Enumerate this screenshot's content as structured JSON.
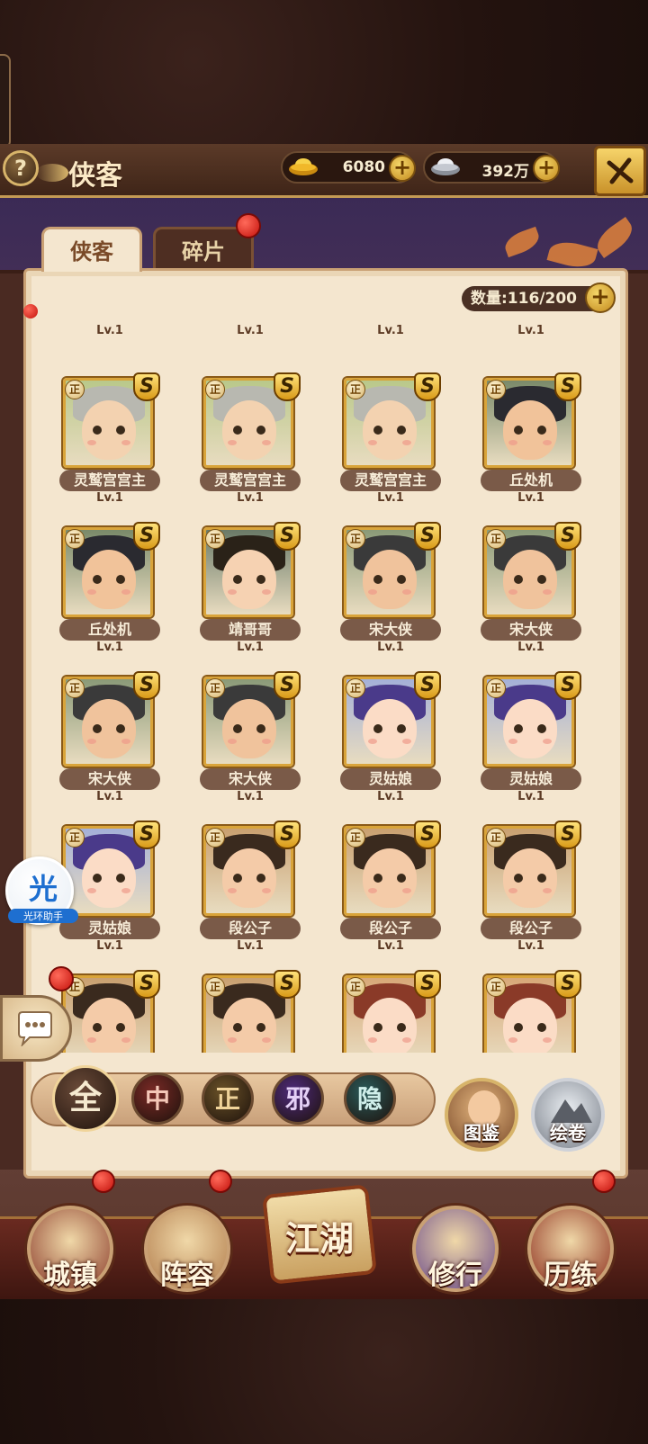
{
  "header": {
    "title": "侠客",
    "gold": "6080",
    "silver": "392万"
  },
  "tabs": [
    {
      "label": "侠客",
      "active": true
    },
    {
      "label": "碎片",
      "active": false,
      "badge": true
    }
  ],
  "count_label": "数量:116/200",
  "heroes": [
    {
      "name": "灵鹫宫宫主",
      "level": "Lv.1",
      "skin": "#f3d2b0",
      "hair": "#b8b8b0",
      "bg": "#b9c88a"
    },
    {
      "name": "灵鹫宫宫主",
      "level": "Lv.1",
      "skin": "#f3d2b0",
      "hair": "#b8b8b0",
      "bg": "#b9c88a"
    },
    {
      "name": "灵鹫宫宫主",
      "level": "Lv.1",
      "skin": "#f3d2b0",
      "hair": "#b8b8b0",
      "bg": "#b9c88a"
    },
    {
      "name": "丘处机",
      "level": "Lv.1",
      "skin": "#f1c39a",
      "hair": "#2a2a30",
      "bg": "#7a8a6a"
    },
    {
      "name": "丘处机",
      "level": "Lv.1",
      "skin": "#f1c39a",
      "hair": "#2a2a30",
      "bg": "#7a8a6a"
    },
    {
      "name": "靖哥哥",
      "level": "Lv.1",
      "skin": "#f6d2b2",
      "hair": "#2a2218",
      "bg": "#6a7a68"
    },
    {
      "name": "宋大侠",
      "level": "Lv.1",
      "skin": "#f0c39c",
      "hair": "#3a3a3a",
      "bg": "#8a9a78"
    },
    {
      "name": "宋大侠",
      "level": "Lv.1",
      "skin": "#f0c39c",
      "hair": "#3a3a3a",
      "bg": "#8a9a78"
    },
    {
      "name": "宋大侠",
      "level": "Lv.1",
      "skin": "#f0c39c",
      "hair": "#3a3a3a",
      "bg": "#8a9a78"
    },
    {
      "name": "宋大侠",
      "level": "Lv.1",
      "skin": "#f0c39c",
      "hair": "#3a3a3a",
      "bg": "#8a9a78"
    },
    {
      "name": "灵姑娘",
      "level": "Lv.1",
      "skin": "#fbdcc6",
      "hair": "#4a3a8a",
      "bg": "#a4b0d8"
    },
    {
      "name": "灵姑娘",
      "level": "Lv.1",
      "skin": "#fbdcc6",
      "hair": "#4a3a8a",
      "bg": "#a4b0d8"
    },
    {
      "name": "灵姑娘",
      "level": "Lv.1",
      "skin": "#fbdcc6",
      "hair": "#4a3a8a",
      "bg": "#a4b0d8"
    },
    {
      "name": "段公子",
      "level": "Lv.1",
      "skin": "#f4cba8",
      "hair": "#3a2a1e",
      "bg": "#c9a070"
    },
    {
      "name": "段公子",
      "level": "Lv.1",
      "skin": "#f4cba8",
      "hair": "#3a2a1e",
      "bg": "#c9a070"
    },
    {
      "name": "段公子",
      "level": "Lv.1",
      "skin": "#f4cba8",
      "hair": "#3a2a1e",
      "bg": "#c9a070"
    },
    {
      "name": "",
      "level": "",
      "skin": "#f4cba8",
      "hair": "#3a2a1e",
      "bg": "#c9a070"
    },
    {
      "name": "",
      "level": "",
      "skin": "#f4cba8",
      "hair": "#3a2a1e",
      "bg": "#c9a070"
    },
    {
      "name": "",
      "level": "",
      "skin": "#fbdcc6",
      "hair": "#8a3a28",
      "bg": "#d8a878"
    },
    {
      "name": "",
      "level": "",
      "skin": "#fbdcc6",
      "hair": "#8a3a28",
      "bg": "#d8a878"
    }
  ],
  "top_partial_levels": [
    "Lv.1",
    "Lv.1",
    "Lv.1",
    "Lv.1"
  ],
  "faction_badge": "正",
  "rank_badge": "S",
  "filters": [
    {
      "label": "全",
      "color": "#f5ead0",
      "bg": "#6a4a38",
      "selected": true
    },
    {
      "label": "中",
      "color": "#f4c8b8",
      "bg": "#7a2a26"
    },
    {
      "label": "正",
      "color": "#f0d49a",
      "bg": "#6a5228"
    },
    {
      "label": "邪",
      "color": "#e4d0f6",
      "bg": "#4e2a7a"
    },
    {
      "label": "隐",
      "color": "#cfeeea",
      "bg": "#2a5a5a"
    }
  ],
  "side_buttons": {
    "codex": "图鉴",
    "scrolls": "绘卷"
  },
  "assistant": {
    "glyph": "光",
    "label": "光环助手"
  },
  "nav": [
    {
      "label": "城镇",
      "badge": true
    },
    {
      "label": "阵容",
      "badge": true
    },
    {
      "label": "江湖",
      "badge": false
    },
    {
      "label": "修行",
      "badge": false
    },
    {
      "label": "历练",
      "badge": true
    }
  ],
  "colors": {
    "gold": "#d9a43a",
    "panel": "#f4e6cf",
    "badge_red": "#c4120c"
  }
}
